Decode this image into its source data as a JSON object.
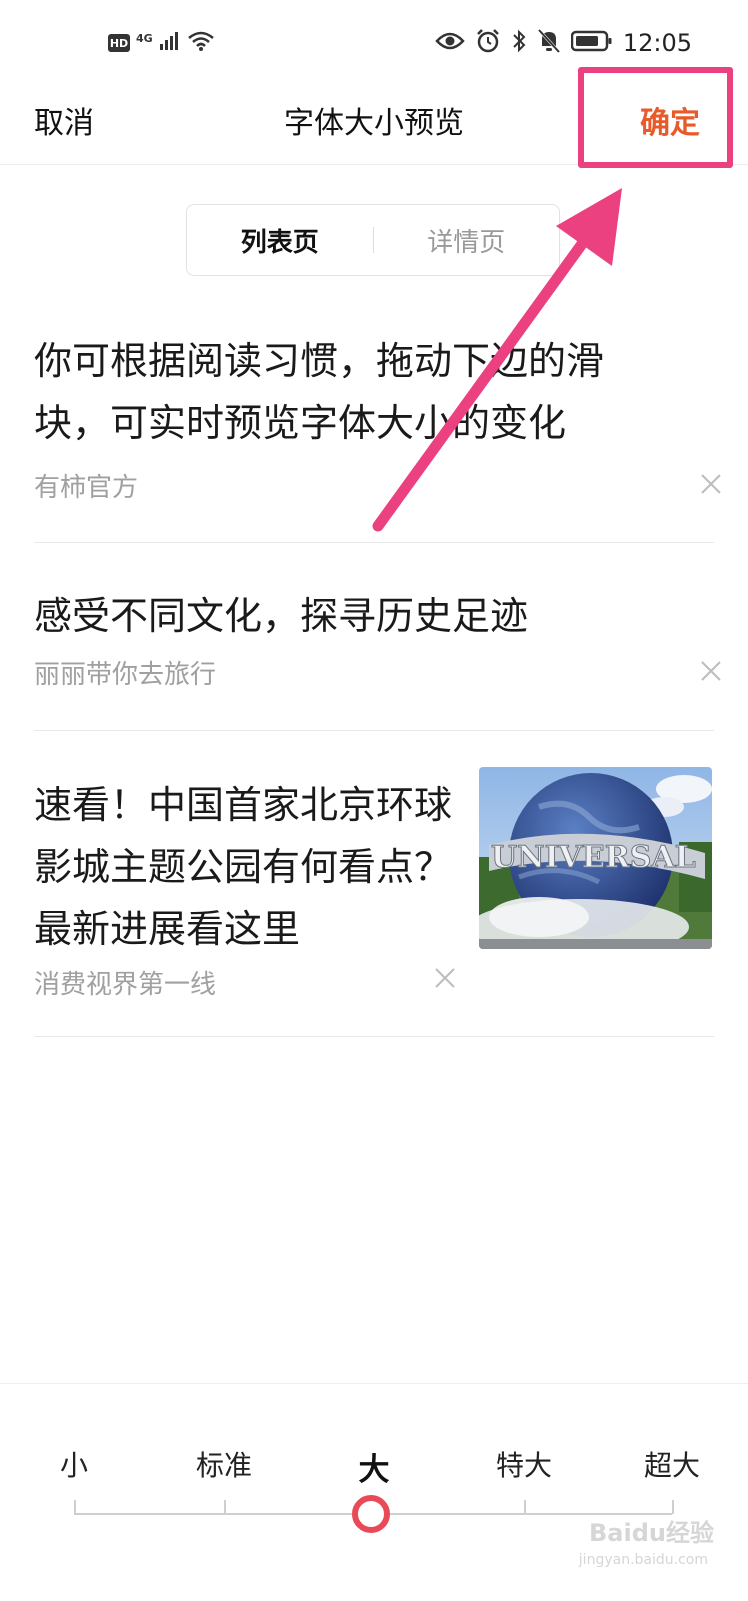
{
  "status_bar": {
    "hd_badge": "HD",
    "network": "4G",
    "time": "12:05",
    "icons": [
      "signal-icon",
      "wifi-icon",
      "eye-icon",
      "alarm-icon",
      "bluetooth-icon",
      "mute-icon",
      "battery-icon"
    ]
  },
  "header": {
    "cancel_label": "取消",
    "title": "字体大小预览",
    "confirm_label": "确定"
  },
  "tabs": [
    {
      "label": "列表页",
      "active": true
    },
    {
      "label": "详情页",
      "active": false
    }
  ],
  "feed": {
    "items": [
      {
        "title": "你可根据阅读习惯，拖动下边的滑块，可实时预览字体大小的变化",
        "source": "有柿官方"
      },
      {
        "title": "感受不同文化，探寻历史足迹",
        "source": "丽丽带你去旅行"
      },
      {
        "title": "速看！中国首家北京环球影城主题公园有何看点？最新进展看这里",
        "source": "消费视界第一线",
        "thumbnail_text": "UNIVERSAL"
      }
    ]
  },
  "font_size_slider": {
    "options": [
      "小",
      "标准",
      "大",
      "特大",
      "超大"
    ],
    "selected": "大",
    "selected_index": 2
  },
  "watermark": {
    "text": "Baidu经验",
    "sub": "jingyan.baidu.com"
  },
  "colors": {
    "accent": "#e85a2a",
    "highlight": "#ec4180",
    "knob": "#e94a57"
  }
}
